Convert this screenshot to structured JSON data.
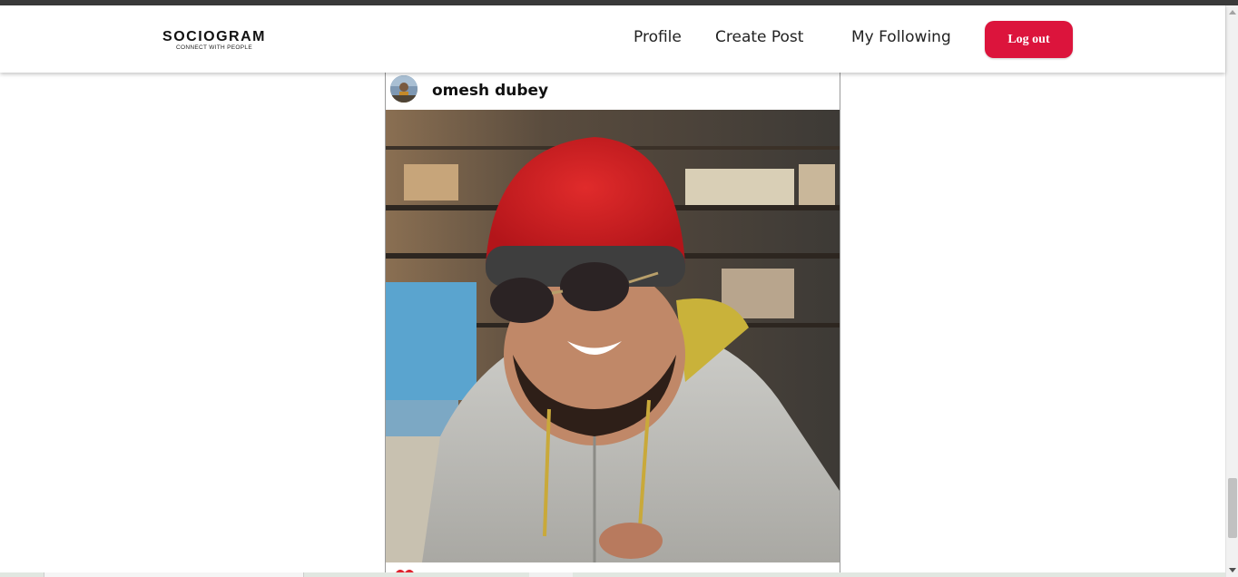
{
  "brand": {
    "title": "SOCIOGRAM",
    "subtitle": "CONNECT WITH PEOPLE"
  },
  "nav": {
    "links": [
      {
        "label": "Profile"
      },
      {
        "label": "Create Post"
      },
      {
        "label": "My Following"
      }
    ],
    "logout_label": "Log out"
  },
  "post": {
    "username": "omesh dubey",
    "image_icon": "post-photo",
    "like_icon": "heart-icon"
  },
  "colors": {
    "accent": "#dc143c",
    "like": "#e0242f",
    "text": "#111111",
    "topstrip": "#3a3a3a"
  }
}
